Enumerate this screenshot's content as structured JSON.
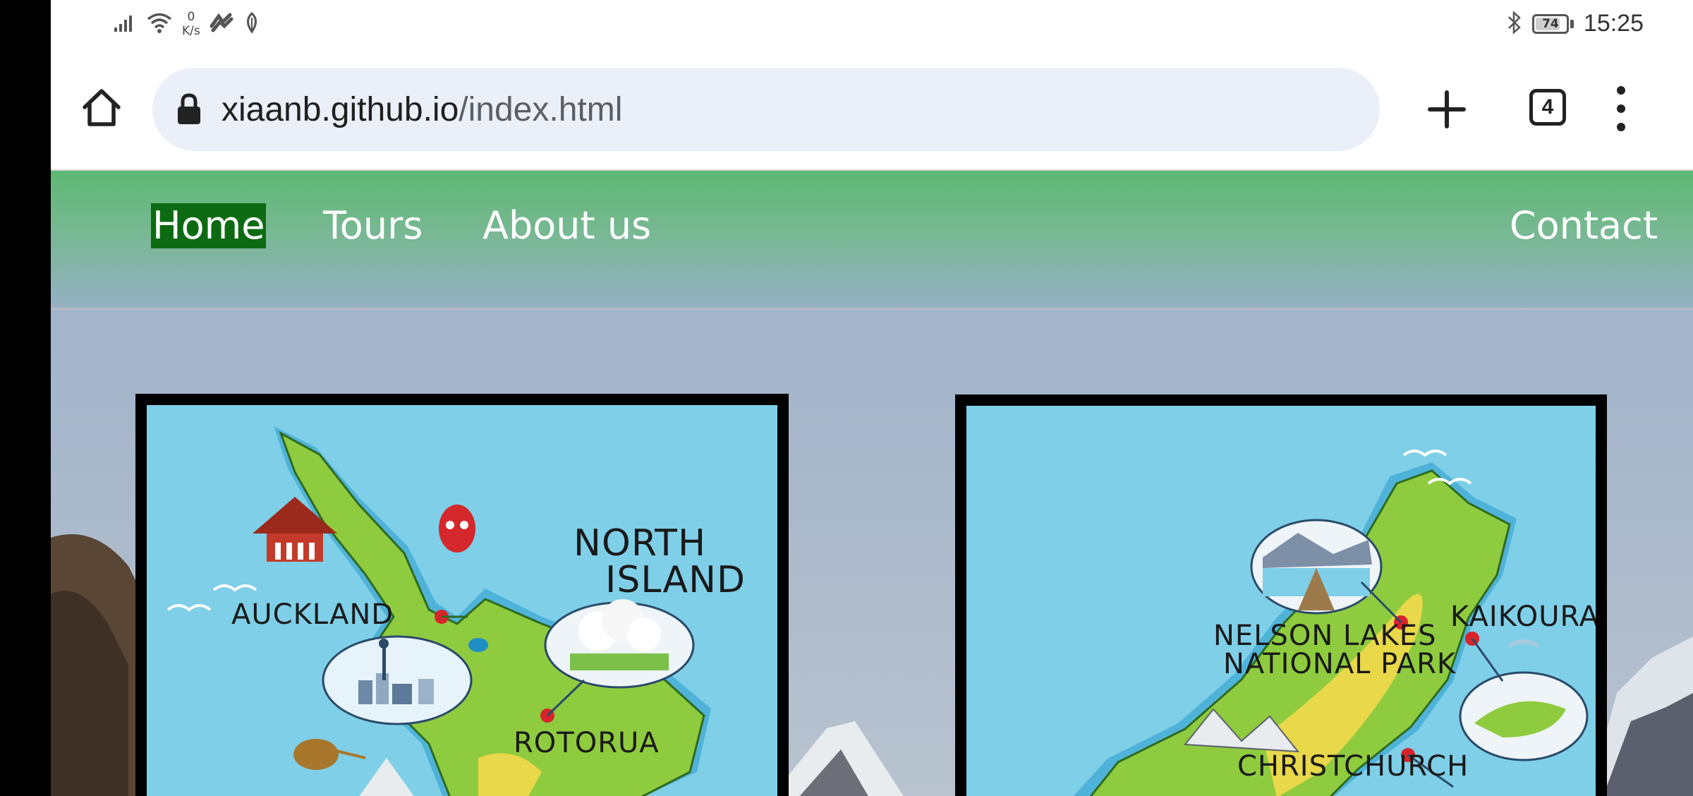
{
  "status_bar": {
    "net_speed_value": "0",
    "net_speed_unit": "K/s",
    "battery_level": "74",
    "time": "15:25"
  },
  "browser": {
    "url_domain": "xiaanb.github.io",
    "url_path": "/index.html",
    "tab_count": "4"
  },
  "nav": {
    "home": "Home",
    "tours": "Tours",
    "about": "About us",
    "contact": "Contact"
  },
  "maps": {
    "north": {
      "title_line1": "NORTH",
      "title_line2": "ISLAND",
      "label_auckland": "AUCKLAND",
      "label_rotorua": "ROTORUA"
    },
    "south": {
      "label_nelson_line1": "NELSON LAKES",
      "label_nelson_line2": "NATIONAL PARK",
      "label_kaikoura": "KAIKOURA",
      "label_christchurch": "CHRISTCHURCH"
    }
  },
  "colors": {
    "nav_active_bg": "#0c6b12",
    "nav_gradient_top": "#5db874",
    "map_sea": "#7fcfe8",
    "map_land": "#8fcb3e",
    "map_inland": "#e8d84a",
    "url_bar_bg": "#ebeff8"
  }
}
